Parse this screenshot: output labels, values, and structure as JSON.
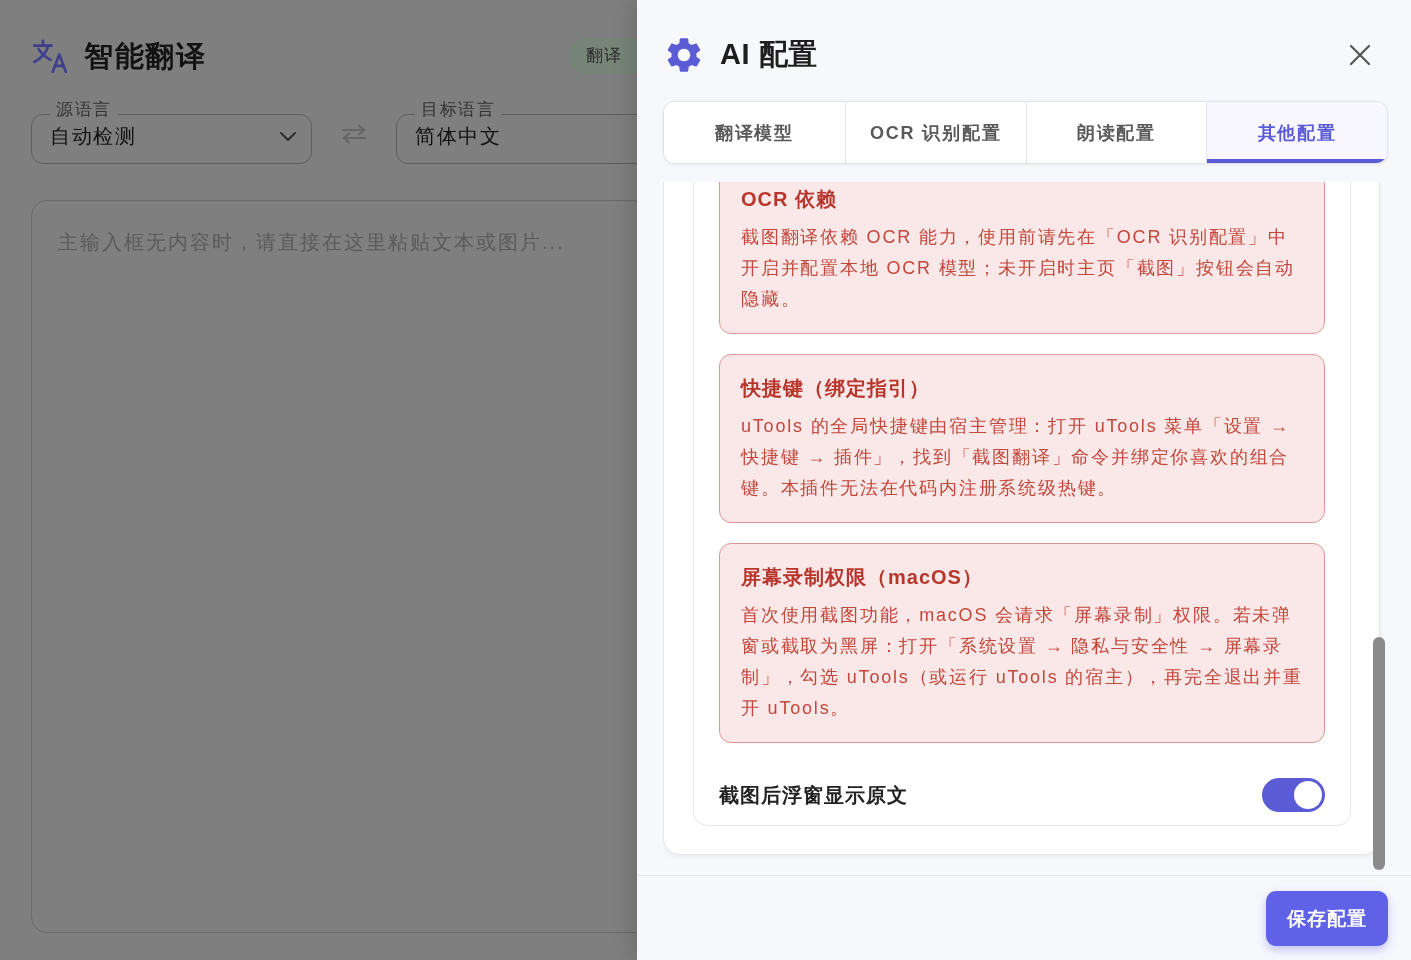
{
  "app": {
    "title": "智能翻译",
    "mode_pill": "翻译",
    "source_language": {
      "label": "源语言",
      "value": "自动检测"
    },
    "target_language": {
      "label": "目标语言",
      "value": "简体中文"
    },
    "input": {
      "placeholder": "主输入框无内容时，请直接在这里粘贴文本或图片..."
    }
  },
  "drawer": {
    "title": "AI 配置",
    "tabs": [
      {
        "label": "翻译模型",
        "selected": false
      },
      {
        "label": "OCR 识别配置",
        "selected": false
      },
      {
        "label": "朗读配置",
        "selected": false
      },
      {
        "label": "其他配置",
        "selected": true
      }
    ],
    "notes": [
      {
        "title": "OCR 依赖",
        "body": "截图翻译依赖 OCR 能力，使用前请先在「OCR 识别配置」中开启并配置本地 OCR 模型；未开启时主页「截图」按钮会自动隐藏。"
      },
      {
        "title": "快捷键（绑定指引）",
        "body": "uTools 的全局快捷键由宿主管理：打开 uTools 菜单「设置 → 快捷键 → 插件」，找到「截图翻译」命令并绑定你喜欢的组合键。本插件无法在代码内注册系统级热键。"
      },
      {
        "title": "屏幕录制权限（macOS）",
        "body": "首次使用截图功能，macOS 会请求「屏幕录制」权限。若未弹窗或截取为黑屏：打开「系统设置 → 隐私与安全性 → 屏幕录制」，勾选 uTools（或运行 uTools 的宿主），再完全退出并重开 uTools。"
      }
    ],
    "settings": [
      {
        "label": "截图后浮窗显示原文",
        "on": true
      }
    ],
    "save_button": "保存配置"
  }
}
